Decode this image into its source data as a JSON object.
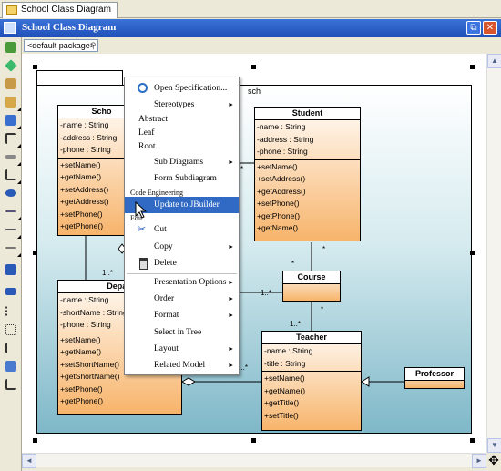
{
  "tab": {
    "label": "School Class Diagram"
  },
  "window": {
    "title": "School Class Diagram",
    "restore": "⧉",
    "close": "✕"
  },
  "package_field": {
    "value": "<default package>",
    "search_icon": "magnifier-icon"
  },
  "diagram": {
    "package_name": "sch",
    "classes": {
      "school": {
        "name": "Scho",
        "attributes": [
          "-name : String",
          "-address : String",
          "-phone : String"
        ],
        "operations": [
          "+setName()",
          "+getName()",
          "+setAddress()",
          "+getAddress()",
          "+setPhone()",
          "+getPhone()"
        ]
      },
      "student": {
        "name": "Student",
        "attributes": [
          "-name : String",
          "-address : String",
          "-phone : String"
        ],
        "operations": [
          "+setName()",
          "+setAddress()",
          "+getAddress()",
          "+setPhone()",
          "+getPhone()",
          "+getName()"
        ]
      },
      "department": {
        "name": "Depart",
        "attributes": [
          "-name : String",
          "-shortName : String",
          "-phone : String"
        ],
        "operations": [
          "+setName()",
          "+getName()",
          "+setShortName()",
          "+getShortName()",
          "+setPhone()",
          "+getPhone()"
        ]
      },
      "course": {
        "name": "Course"
      },
      "teacher": {
        "name": "Teacher",
        "attributes": [
          "-name : String",
          "-title : String"
        ],
        "operations": [
          "+setName()",
          "+getName()",
          "+getTitle()",
          "+setTitle()"
        ]
      },
      "professor": {
        "name": "Professor"
      }
    },
    "multiplicities": {
      "m1": "1..*",
      "m2": "*",
      "m3": "*",
      "m4": "*",
      "m5": "1..*",
      "m6": "1..*",
      "m7": "*",
      "m8": "1..*"
    }
  },
  "context_menu": {
    "open_spec": "Open Specification...",
    "stereotypes": "Stereotypes",
    "abstract": "Abstract",
    "leaf": "Leaf",
    "root": "Root",
    "sub_diagrams": "Sub Diagrams",
    "form_subdiagram": "Form Subdiagram",
    "code_engineering": "Code Engineering",
    "update_jbuilder": "Update to JBuilder",
    "edit": "Edit",
    "cut": "Cut",
    "copy": "Copy",
    "delete": "Delete",
    "presentation_options": "Presentation Options",
    "order": "Order",
    "format": "Format",
    "select_in_tree": "Select in Tree",
    "layout": "Layout",
    "related_model": "Related Model",
    "arrow": "►"
  },
  "scroll": {
    "up": "▲",
    "down": "▼",
    "left": "◄",
    "right": "►",
    "corner": "✥"
  }
}
